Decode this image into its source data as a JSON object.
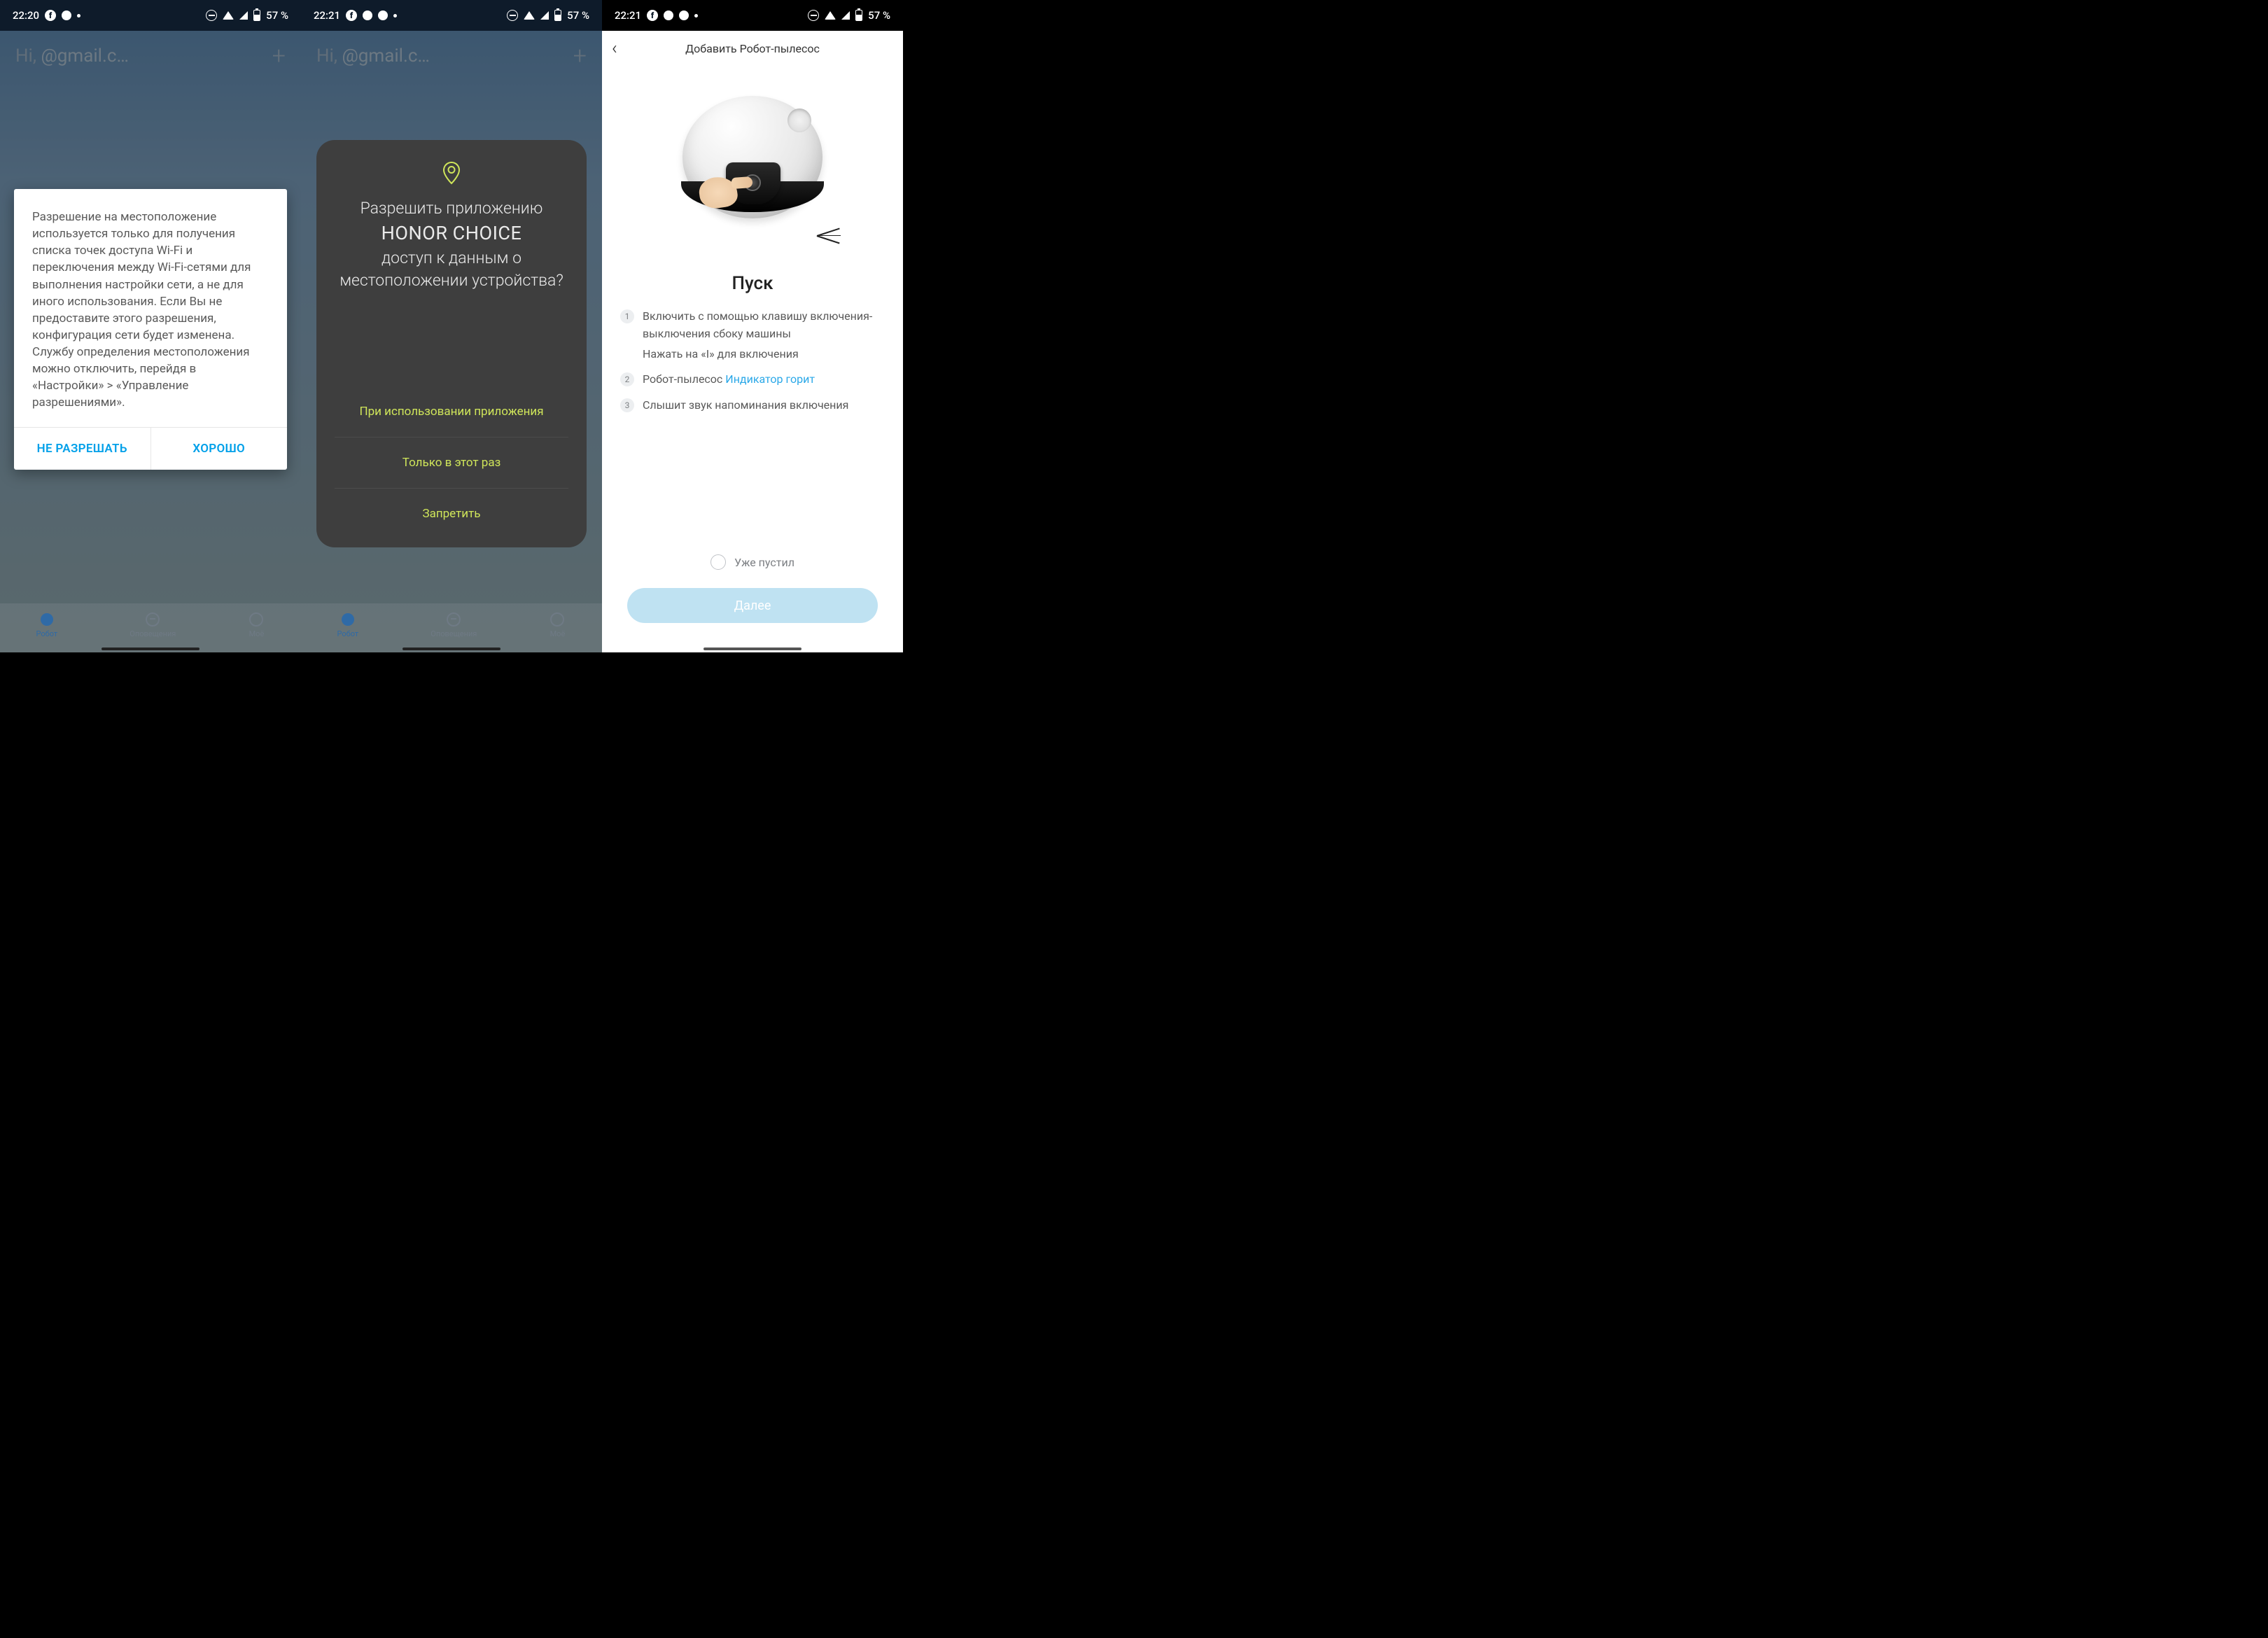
{
  "status": {
    "s1_time": "22:20",
    "s2_time": "22:21",
    "s3_time": "22:21",
    "battery": "57 %"
  },
  "bg": {
    "greeting": "Hi,",
    "email": "@gmail.c…",
    "tabs": {
      "robot": "Робот",
      "alerts": "Оповещения",
      "mine": "Моё"
    }
  },
  "dialog1": {
    "body": "Разрешение на местоположение используется только для получения списка точек доступа Wi-Fi и переключения между Wi-Fi-сетями для выполнения настройки сети, а не для иного использования. Если Вы не предоставите этого разрешения, конфигурация сети будет изменена. Службу определения местоположения можно отключить, перейдя в «Настройки» > «Управление разрешениями».",
    "deny": "НЕ РАЗРЕШАТЬ",
    "ok": "ХОРОШО"
  },
  "sheet": {
    "line1": "Разрешить приложению",
    "app": "HONOR CHOICE",
    "line2": "доступ к данным о местоположении устройства?",
    "opt_while": "При использовании приложения",
    "opt_once": "Только в этот раз",
    "opt_deny": "Запретить"
  },
  "add": {
    "title": "Добавить Робот-пылесос",
    "heading": "Пуск",
    "step1a": "Включить с помощью клавишу включения-выключения сбоку машины",
    "step1b": "Нажать на «I» для включения",
    "step2a": "Робот-пылесос ",
    "step2link": "Индикатор горит",
    "step3": "Слышит звук напоминания включения",
    "already": "Уже пустил",
    "next": "Далее"
  }
}
